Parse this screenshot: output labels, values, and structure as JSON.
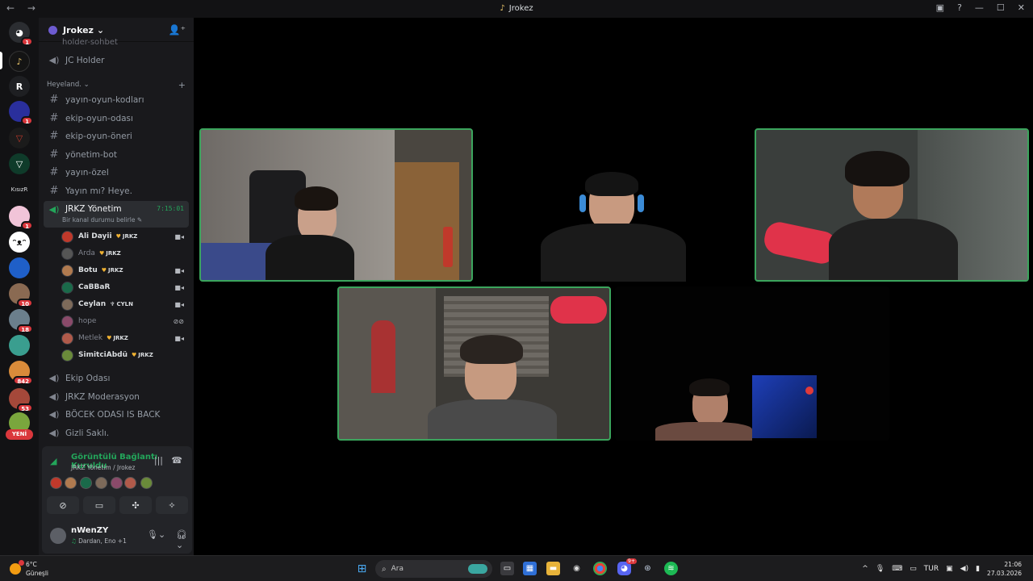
{
  "window": {
    "title": "Jrokez",
    "title_icon": "music-note-icon",
    "nav": "← →",
    "controls": [
      "inbox-icon",
      "help-icon",
      "minimize-icon",
      "maximize-icon",
      "close-icon"
    ]
  },
  "guilds": {
    "items": [
      {
        "name": "discord-home",
        "badge": "1"
      },
      {
        "name": "jrokez-server",
        "badge": ""
      },
      {
        "name": "r-server",
        "label": "R",
        "badge": ""
      },
      {
        "name": "blue-server",
        "badge": "1"
      },
      {
        "name": "v-server",
        "badge": ""
      },
      {
        "name": "green-v-server",
        "badge": ""
      },
      {
        "name": "kisizr-server",
        "label": "KısızR",
        "badge": ""
      },
      {
        "name": "anime-server",
        "badge": "1"
      },
      {
        "name": "face-server",
        "badge": ""
      },
      {
        "name": "sonic-server",
        "badge": ""
      },
      {
        "name": "avatar-server-10",
        "badge": "10"
      },
      {
        "name": "avatar-server-18",
        "badge": "18"
      },
      {
        "name": "teal-server",
        "badge": ""
      },
      {
        "name": "avatar-server-842",
        "badge": "842"
      },
      {
        "name": "avatar-server-53",
        "badge": "53"
      },
      {
        "name": "shrek-server",
        "badge": ""
      }
    ],
    "new_label": "YENİ"
  },
  "server": {
    "name": "Jrokez",
    "partial_channel": "holder-sohbet",
    "channels_top": [
      {
        "type": "voice",
        "label": "JC Holder"
      }
    ],
    "category": "Heyeland.",
    "text_channels": [
      "yayın-oyun-kodları",
      "ekip-oyun-odası",
      "ekip-oyun-öneri",
      "yönetim-bot",
      "yayın-özel",
      "Yayın mı? Heye."
    ],
    "active_voice": {
      "label": "JRKZ Yönetim",
      "timer": "7:15:01",
      "status": "Bir kanal durumu belirle"
    },
    "voice_users": [
      {
        "name": "Ali Dayii",
        "tag": "JRKZ",
        "tag_icon": "heart",
        "cam": true,
        "dim": false
      },
      {
        "name": "Arda",
        "tag": "JRKZ",
        "tag_icon": "heart",
        "cam": false,
        "dim": true
      },
      {
        "name": "Botu",
        "tag": "JRKZ",
        "tag_icon": "heart",
        "cam": true,
        "dim": false
      },
      {
        "name": "CaBBaR",
        "tag": "",
        "tag_icon": "",
        "cam": true,
        "dim": false
      },
      {
        "name": "Ceylan",
        "tag": "CYLN",
        "tag_icon": "trophy",
        "cam": true,
        "dim": false
      },
      {
        "name": "hope",
        "tag": "",
        "tag_icon": "",
        "cam": false,
        "dim": true
      },
      {
        "name": "Metlek",
        "tag": "JRKZ",
        "tag_icon": "heart",
        "cam": true,
        "dim": true
      },
      {
        "name": "SimitciAbdü",
        "tag": "JRKZ",
        "tag_icon": "heart",
        "cam": false,
        "dim": false
      }
    ],
    "channels_bottom": [
      "Ekip Odası",
      "JRKZ Moderasyon",
      "BÖCEK ODASI IS BACK",
      "Gizli Saklı."
    ]
  },
  "voice_panel": {
    "status": "Görüntülü Bağlantı Kuruldu",
    "channel": "JRKZ Yönetim / Jrokez",
    "buttons": [
      "camera-off-icon",
      "screen-share-icon",
      "activities-icon",
      "soundboard-icon"
    ]
  },
  "user_panel": {
    "username": "nWenZY",
    "status": "Dardan, Eno +1"
  },
  "taskbar": {
    "weather_temp": "6°C",
    "weather_desc": "Güneşli",
    "search_placeholder": "Ara",
    "language": "TUR",
    "time": "21:06",
    "date": "27.03.2026",
    "discord_badge": "9+"
  },
  "colors": {
    "speaking": "#3ba55d",
    "online": "#23a55a",
    "badge": "#da373c"
  }
}
